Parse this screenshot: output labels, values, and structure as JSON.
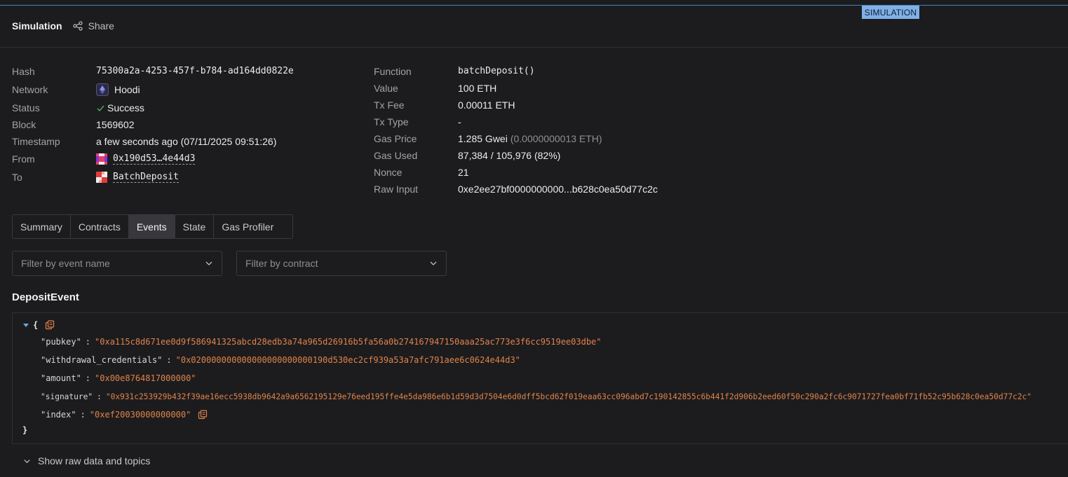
{
  "badge": "SIMULATION",
  "header": {
    "title": "Simulation",
    "share_label": "Share"
  },
  "tx": {
    "left": [
      {
        "key": "Hash",
        "value": "75300a2a-4253-457f-b784-ad164dd0822e"
      },
      {
        "key": "Network",
        "value": "Hoodi"
      },
      {
        "key": "Status",
        "value": "Success"
      },
      {
        "key": "Block",
        "value": "1569602"
      },
      {
        "key": "Timestamp",
        "value": "a few seconds ago (07/11/2025 09:51:26)"
      },
      {
        "key": "From",
        "value": "0x190d53…4e44d3"
      },
      {
        "key": "To",
        "value": "BatchDeposit"
      }
    ],
    "right": [
      {
        "key": "Function",
        "value": "batchDeposit()"
      },
      {
        "key": "Value",
        "value": "100 ETH"
      },
      {
        "key": "Tx Fee",
        "value": "0.00011 ETH"
      },
      {
        "key": "Tx Type",
        "value": "-"
      },
      {
        "key": "Gas Price",
        "value": "1.285 Gwei",
        "extra": "(0.0000000013 ETH)"
      },
      {
        "key": "Gas Used",
        "value": "87,384 / 105,976 (82%)"
      },
      {
        "key": "Nonce",
        "value": "21"
      },
      {
        "key": "Raw Input",
        "value": "0xe2ee27bf0000000000...b628c0ea50d77c2c"
      }
    ]
  },
  "tabs": [
    "Summary",
    "Contracts",
    "Events",
    "State",
    "Gas Profiler"
  ],
  "active_tab": "Events",
  "filters": {
    "event_placeholder": "Filter by event name",
    "contract_placeholder": "Filter by contract"
  },
  "event": {
    "name": "DepositEvent",
    "fields": [
      {
        "key": "\"pubkey\"",
        "value": "\"0xa115c8d671ee0d9f586941325abcd28edb3a74a965d26916b5fa56a0b274167947150aaa25ac773e3f6cc9519ee03dbe\""
      },
      {
        "key": "\"withdrawal_credentials\"",
        "value": "\"0x020000000000000000000000190d530ec2cf939a53a7afc791aee6c0624e44d3\""
      },
      {
        "key": "\"amount\"",
        "value": "\"0x00e8764817000000\""
      },
      {
        "key": "\"signature\"",
        "value": "\"0x931c253929b432f39ae16ecc5938db9642a9a6562195129e76eed195ffe4e5da986e6b1d59d3d7504e6d0dff5bcd62f019eaa63cc096abd7c190142855c6b441f2d906b2eed60f50c290a2fc6c9071727fea0bf71fb52c95b628c0ea50d77c2c\""
      },
      {
        "key": "\"index\"",
        "value": "\"0xef20030000000000\""
      }
    ],
    "open_brace": "{",
    "close_brace": "}"
  },
  "raw_toggle_label": "Show raw data and topics",
  "colors": {
    "accent": "#7fb0e8",
    "success": "#4caf6a",
    "json_value": "#e0834a",
    "background": "#1c1c1e"
  }
}
